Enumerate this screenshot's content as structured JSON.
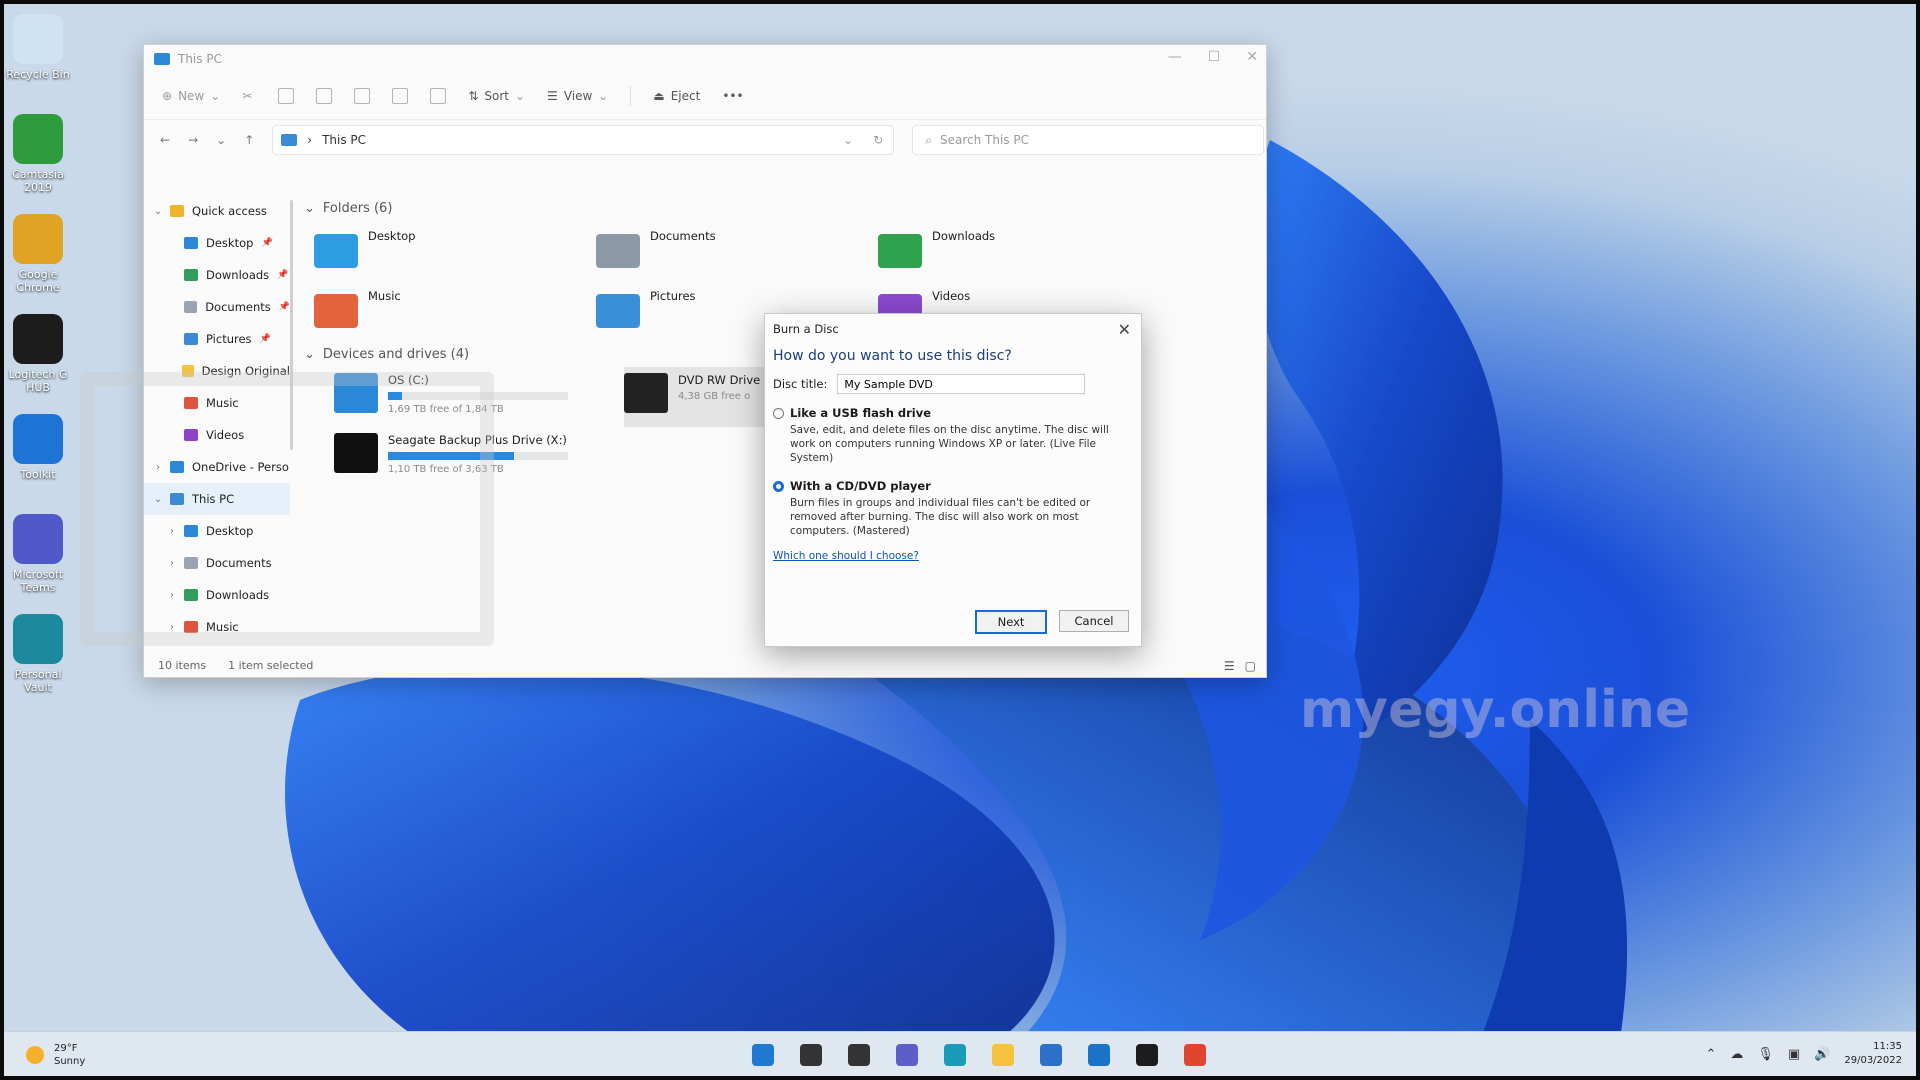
{
  "desktop": {
    "icons": [
      {
        "name": "recycle-bin-icon",
        "label": "Recycle Bin",
        "color": "#cfe3f5"
      },
      {
        "name": "camtasia-icon",
        "label": "Camtasia 2019",
        "color": "#2e9b3c"
      },
      {
        "name": "chrome-icon",
        "label": "Google Chrome",
        "color": "#e0a323"
      },
      {
        "name": "logitech-icon",
        "label": "Logitech G HUB",
        "color": "#1c1c1c"
      },
      {
        "name": "toolkit-icon",
        "label": "Toolkit",
        "color": "#1e73d6"
      },
      {
        "name": "teams-icon",
        "label": "Microsoft Teams",
        "color": "#5059c9"
      },
      {
        "name": "personal-vault-icon",
        "label": "Personal Vault",
        "color": "#1c8a9e"
      }
    ]
  },
  "explorer": {
    "title": "This PC",
    "toolbar": {
      "new": "New",
      "sort": "Sort",
      "view": "View",
      "eject": "Eject",
      "more": "•••"
    },
    "address": "This PC",
    "search_placeholder": "Search This PC",
    "nav": [
      {
        "label": "Quick access",
        "icon": "star-icon",
        "color": "#f0b429",
        "chev": "v",
        "pin": false,
        "indent": 0
      },
      {
        "label": "Desktop",
        "icon": "desktop-icon",
        "color": "#2b88d8",
        "chev": "",
        "pin": true,
        "indent": 1
      },
      {
        "label": "Downloads",
        "icon": "downloads-icon",
        "color": "#2f9e5b",
        "chev": "",
        "pin": true,
        "indent": 1
      },
      {
        "label": "Documents",
        "icon": "documents-icon",
        "color": "#9aa4b1",
        "chev": "",
        "pin": true,
        "indent": 1
      },
      {
        "label": "Pictures",
        "icon": "pictures-icon",
        "color": "#3a8ad6",
        "chev": "",
        "pin": true,
        "indent": 1
      },
      {
        "label": "Design Original",
        "icon": "folder-icon",
        "color": "#f4c23e",
        "chev": "",
        "pin": false,
        "indent": 1
      },
      {
        "label": "Music",
        "icon": "music-icon",
        "color": "#e0533c",
        "chev": "",
        "pin": false,
        "indent": 1
      },
      {
        "label": "Videos",
        "icon": "videos-icon",
        "color": "#8a43c9",
        "chev": "",
        "pin": false,
        "indent": 1
      },
      {
        "label": "OneDrive - Perso",
        "icon": "onedrive-icon",
        "color": "#2b88d8",
        "chev": ">",
        "pin": false,
        "indent": 0
      },
      {
        "label": "This PC",
        "icon": "pc-icon",
        "color": "#3a8ad6",
        "chev": "v",
        "pin": false,
        "indent": 0,
        "selected": true
      },
      {
        "label": "Desktop",
        "icon": "desktop-icon",
        "color": "#2b88d8",
        "chev": ">",
        "pin": false,
        "indent": 1
      },
      {
        "label": "Documents",
        "icon": "documents-icon",
        "color": "#9aa4b1",
        "chev": ">",
        "pin": false,
        "indent": 1
      },
      {
        "label": "Downloads",
        "icon": "downloads-icon",
        "color": "#2f9e5b",
        "chev": ">",
        "pin": false,
        "indent": 1
      },
      {
        "label": "Music",
        "icon": "music-icon",
        "color": "#e0533c",
        "chev": ">",
        "pin": false,
        "indent": 1
      }
    ],
    "folders_header": "Folders (6)",
    "folders": [
      {
        "label": "Desktop",
        "color": "#2b9de0"
      },
      {
        "label": "Documents",
        "color": "#8e99a8"
      },
      {
        "label": "Downloads",
        "color": "#2fa24e"
      },
      {
        "label": "Music",
        "color": "#e3643c"
      },
      {
        "label": "Pictures",
        "color": "#3b8fd9"
      },
      {
        "label": "Videos",
        "color": "#8c4ad0"
      }
    ],
    "drives_header": "Devices and drives (4)",
    "drives": [
      {
        "label": "OS (C:)",
        "free": "1,69 TB free of 1,84 TB",
        "used_fraction": 0.08,
        "color": "#2b88d8",
        "selected": false
      },
      {
        "label": "DVD RW Drive",
        "free": "4,38 GB free o",
        "used_fraction": null,
        "color": "#222222",
        "selected": true
      },
      {
        "label": "Seagate Backup Plus Drive (X:)",
        "free": "1,10 TB free of 3,63 TB",
        "used_fraction": 0.7,
        "color": "#111111",
        "selected": false
      }
    ],
    "status_items": "10 items",
    "status_selected": "1 item selected"
  },
  "dialog": {
    "title": "Burn a Disc",
    "question": "How do you want to use this disc?",
    "disc_title_label": "Disc title:",
    "disc_title_value": "My Sample DVD",
    "option1_title": "Like a USB flash drive",
    "option1_desc": "Save, edit, and delete files on the disc anytime. The disc will work on computers running Windows XP or later. (Live File System)",
    "option2_title": "With a CD/DVD player",
    "option2_desc": "Burn files in groups and individual files can't be edited or removed after burning. The disc will also work on most computers. (Mastered)",
    "link": "Which one should I choose?",
    "next": "Next",
    "cancel": "Cancel"
  },
  "watermark": "myegy.online",
  "taskbar": {
    "weather_temp": "29°F",
    "weather_cond": "Sunny",
    "apps": [
      {
        "name": "start-icon",
        "color": "#1f78d1"
      },
      {
        "name": "search-icon",
        "color": "#333333"
      },
      {
        "name": "task-view-icon",
        "color": "#333333"
      },
      {
        "name": "chat-icon",
        "color": "#5b5fc7"
      },
      {
        "name": "edge-icon",
        "color": "#1a9bb8"
      },
      {
        "name": "file-explorer-icon",
        "color": "#f4c23e"
      },
      {
        "name": "store-icon",
        "color": "#2b70c9"
      },
      {
        "name": "mail-icon",
        "color": "#1a73c8"
      },
      {
        "name": "logitech-taskbar-icon",
        "color": "#1c1c1c"
      },
      {
        "name": "camtasia-taskbar-icon",
        "color": "#e0452f"
      }
    ],
    "time": "11:35",
    "date": "29/03/2022"
  }
}
